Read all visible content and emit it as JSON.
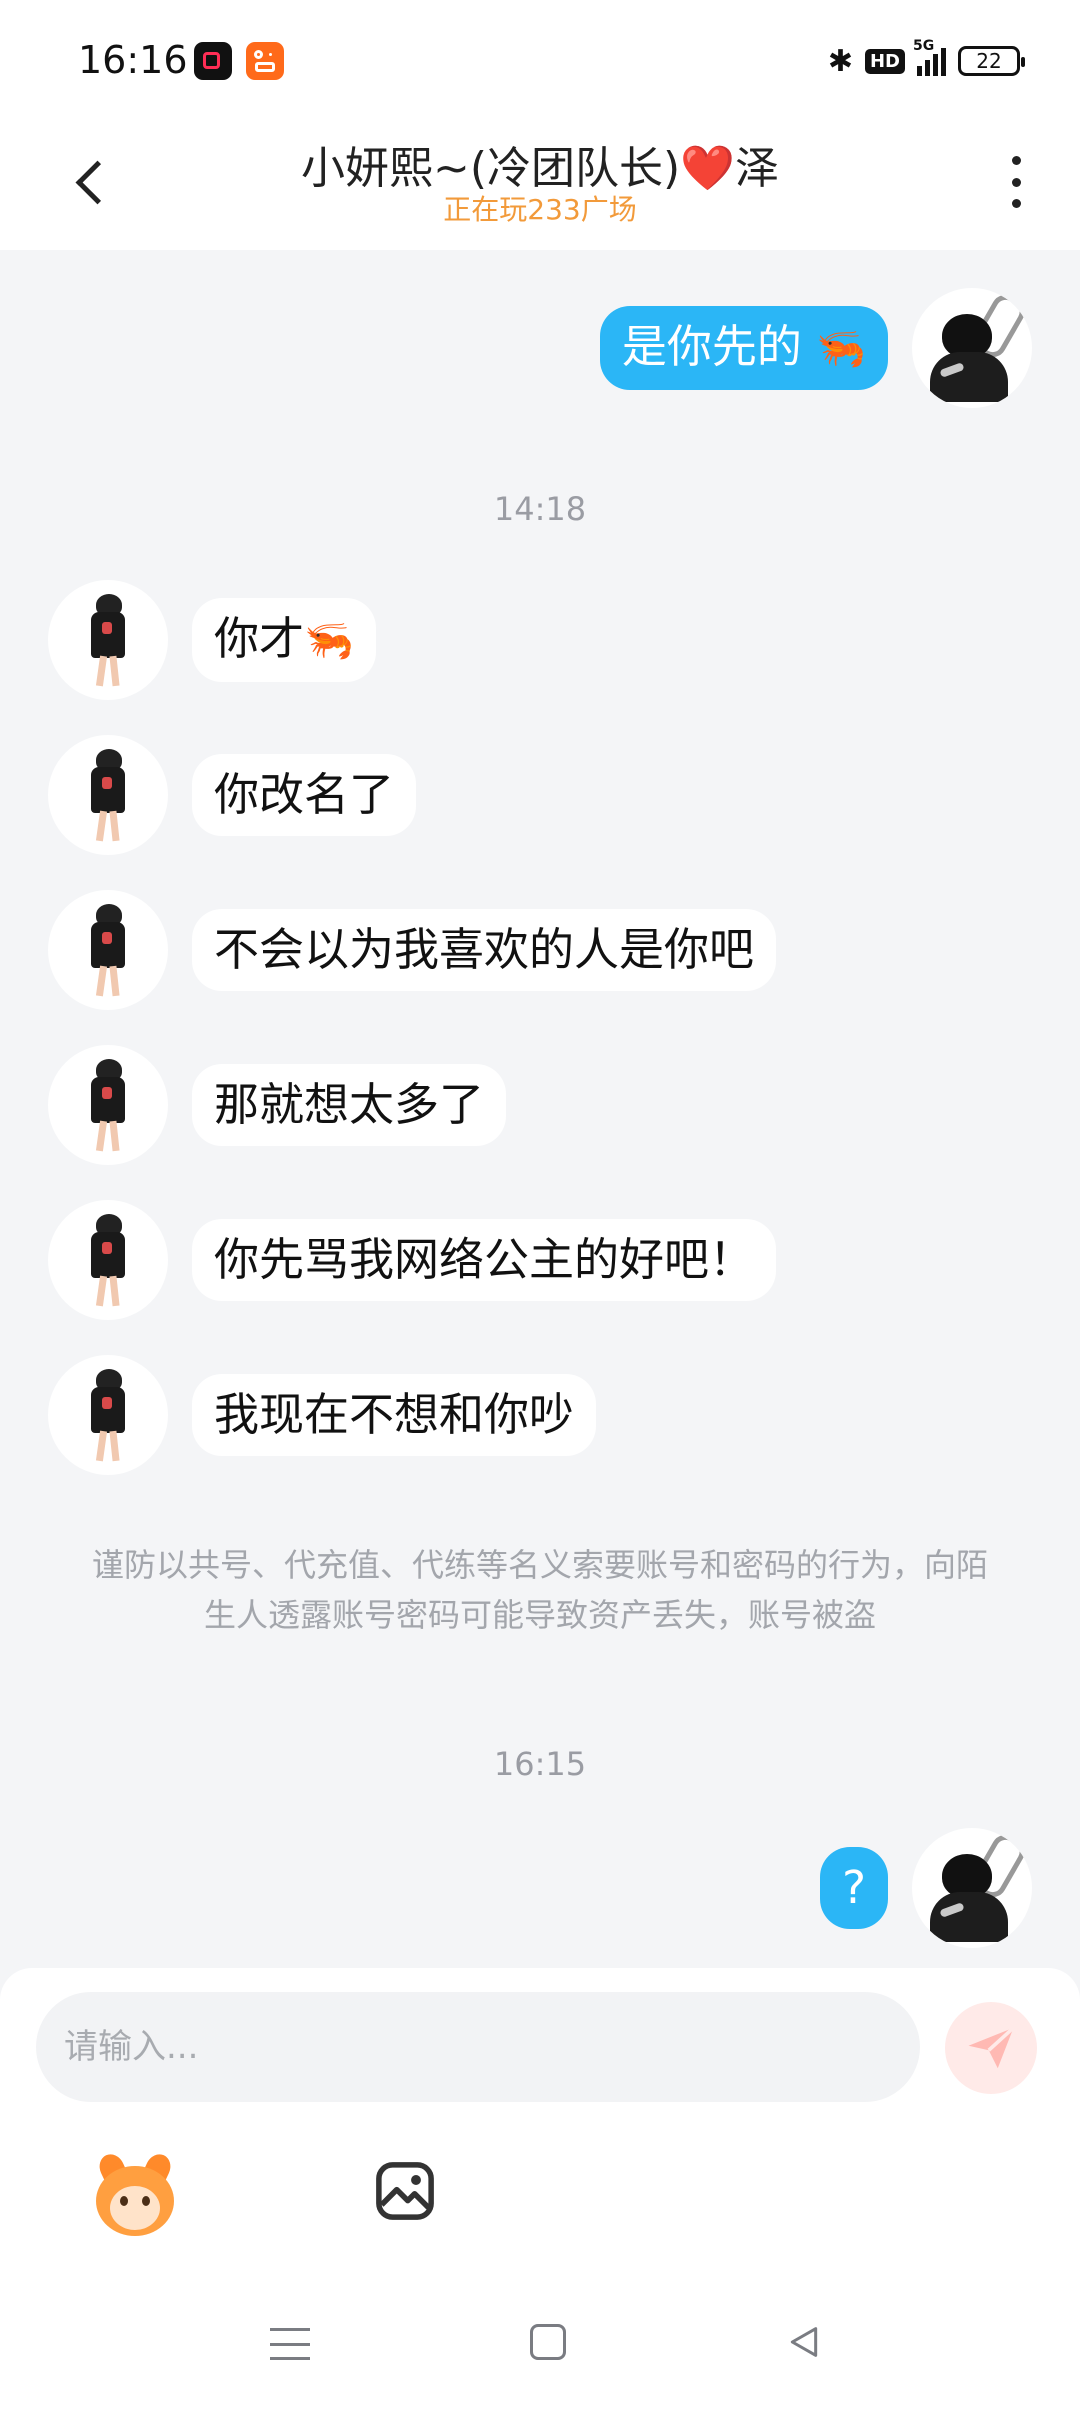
{
  "status_bar": {
    "time": "16:16",
    "hd_label": "HD",
    "network_label": "5G",
    "battery": "22",
    "bluetooth_glyph": "✱"
  },
  "header": {
    "title": "小妍熙~(冷团队长)❤️泽",
    "subtitle": "正在玩233广场"
  },
  "messages": [
    {
      "side": "right",
      "text": "是你先的",
      "emoji": "🦐"
    },
    {
      "side": "time",
      "text": "14:18"
    },
    {
      "side": "left",
      "text": "你才",
      "emoji": "🦐"
    },
    {
      "side": "left",
      "text": "你改名了"
    },
    {
      "side": "left",
      "text": "不会以为我喜欢的人是你吧"
    },
    {
      "side": "left",
      "text": "那就想太多了"
    },
    {
      "side": "left",
      "text": "你先骂我网络公主的好吧！"
    },
    {
      "side": "left",
      "text": "我现在不想和你吵"
    },
    {
      "side": "notice",
      "text": "谨防以共号、代充值、代练等名义索要账号和密码的行为，向陌生人透露账号密码可能导致资产丢失，账号被盗"
    },
    {
      "side": "time",
      "text": "16:15"
    },
    {
      "side": "right",
      "text": "?"
    }
  ],
  "input": {
    "placeholder": "请输入..."
  },
  "colors": {
    "outgoing_bubble": "#2bb6f6",
    "incoming_bubble": "#ffffff",
    "subtitle": "#f29a3a",
    "background": "#f4f5f7"
  },
  "icons": [
    "back-arrow-icon",
    "more-vertical-icon",
    "emoji-icon",
    "image-icon",
    "send-icon",
    "menu-icon",
    "home-icon",
    "back-triangle-icon"
  ]
}
